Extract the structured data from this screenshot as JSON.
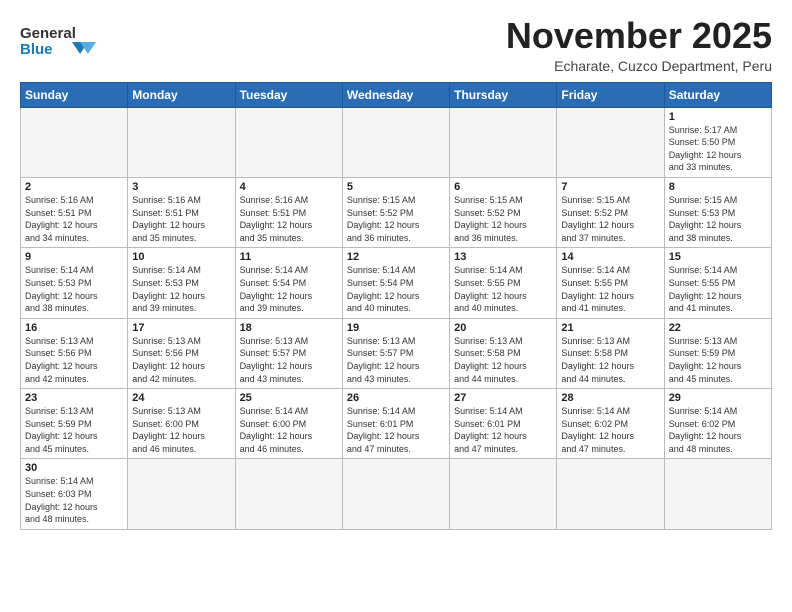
{
  "header": {
    "logo_general": "General",
    "logo_blue": "Blue",
    "month_title": "November 2025",
    "subtitle": "Echarate, Cuzco Department, Peru"
  },
  "weekdays": [
    "Sunday",
    "Monday",
    "Tuesday",
    "Wednesday",
    "Thursday",
    "Friday",
    "Saturday"
  ],
  "weeks": [
    [
      {
        "day": "",
        "info": ""
      },
      {
        "day": "",
        "info": ""
      },
      {
        "day": "",
        "info": ""
      },
      {
        "day": "",
        "info": ""
      },
      {
        "day": "",
        "info": ""
      },
      {
        "day": "",
        "info": ""
      },
      {
        "day": "1",
        "info": "Sunrise: 5:17 AM\nSunset: 5:50 PM\nDaylight: 12 hours\nand 33 minutes."
      }
    ],
    [
      {
        "day": "2",
        "info": "Sunrise: 5:16 AM\nSunset: 5:51 PM\nDaylight: 12 hours\nand 34 minutes."
      },
      {
        "day": "3",
        "info": "Sunrise: 5:16 AM\nSunset: 5:51 PM\nDaylight: 12 hours\nand 35 minutes."
      },
      {
        "day": "4",
        "info": "Sunrise: 5:16 AM\nSunset: 5:51 PM\nDaylight: 12 hours\nand 35 minutes."
      },
      {
        "day": "5",
        "info": "Sunrise: 5:15 AM\nSunset: 5:52 PM\nDaylight: 12 hours\nand 36 minutes."
      },
      {
        "day": "6",
        "info": "Sunrise: 5:15 AM\nSunset: 5:52 PM\nDaylight: 12 hours\nand 36 minutes."
      },
      {
        "day": "7",
        "info": "Sunrise: 5:15 AM\nSunset: 5:52 PM\nDaylight: 12 hours\nand 37 minutes."
      },
      {
        "day": "8",
        "info": "Sunrise: 5:15 AM\nSunset: 5:53 PM\nDaylight: 12 hours\nand 38 minutes."
      }
    ],
    [
      {
        "day": "9",
        "info": "Sunrise: 5:14 AM\nSunset: 5:53 PM\nDaylight: 12 hours\nand 38 minutes."
      },
      {
        "day": "10",
        "info": "Sunrise: 5:14 AM\nSunset: 5:53 PM\nDaylight: 12 hours\nand 39 minutes."
      },
      {
        "day": "11",
        "info": "Sunrise: 5:14 AM\nSunset: 5:54 PM\nDaylight: 12 hours\nand 39 minutes."
      },
      {
        "day": "12",
        "info": "Sunrise: 5:14 AM\nSunset: 5:54 PM\nDaylight: 12 hours\nand 40 minutes."
      },
      {
        "day": "13",
        "info": "Sunrise: 5:14 AM\nSunset: 5:55 PM\nDaylight: 12 hours\nand 40 minutes."
      },
      {
        "day": "14",
        "info": "Sunrise: 5:14 AM\nSunset: 5:55 PM\nDaylight: 12 hours\nand 41 minutes."
      },
      {
        "day": "15",
        "info": "Sunrise: 5:14 AM\nSunset: 5:55 PM\nDaylight: 12 hours\nand 41 minutes."
      }
    ],
    [
      {
        "day": "16",
        "info": "Sunrise: 5:13 AM\nSunset: 5:56 PM\nDaylight: 12 hours\nand 42 minutes."
      },
      {
        "day": "17",
        "info": "Sunrise: 5:13 AM\nSunset: 5:56 PM\nDaylight: 12 hours\nand 42 minutes."
      },
      {
        "day": "18",
        "info": "Sunrise: 5:13 AM\nSunset: 5:57 PM\nDaylight: 12 hours\nand 43 minutes."
      },
      {
        "day": "19",
        "info": "Sunrise: 5:13 AM\nSunset: 5:57 PM\nDaylight: 12 hours\nand 43 minutes."
      },
      {
        "day": "20",
        "info": "Sunrise: 5:13 AM\nSunset: 5:58 PM\nDaylight: 12 hours\nand 44 minutes."
      },
      {
        "day": "21",
        "info": "Sunrise: 5:13 AM\nSunset: 5:58 PM\nDaylight: 12 hours\nand 44 minutes."
      },
      {
        "day": "22",
        "info": "Sunrise: 5:13 AM\nSunset: 5:59 PM\nDaylight: 12 hours\nand 45 minutes."
      }
    ],
    [
      {
        "day": "23",
        "info": "Sunrise: 5:13 AM\nSunset: 5:59 PM\nDaylight: 12 hours\nand 45 minutes."
      },
      {
        "day": "24",
        "info": "Sunrise: 5:13 AM\nSunset: 6:00 PM\nDaylight: 12 hours\nand 46 minutes."
      },
      {
        "day": "25",
        "info": "Sunrise: 5:14 AM\nSunset: 6:00 PM\nDaylight: 12 hours\nand 46 minutes."
      },
      {
        "day": "26",
        "info": "Sunrise: 5:14 AM\nSunset: 6:01 PM\nDaylight: 12 hours\nand 47 minutes."
      },
      {
        "day": "27",
        "info": "Sunrise: 5:14 AM\nSunset: 6:01 PM\nDaylight: 12 hours\nand 47 minutes."
      },
      {
        "day": "28",
        "info": "Sunrise: 5:14 AM\nSunset: 6:02 PM\nDaylight: 12 hours\nand 47 minutes."
      },
      {
        "day": "29",
        "info": "Sunrise: 5:14 AM\nSunset: 6:02 PM\nDaylight: 12 hours\nand 48 minutes."
      }
    ],
    [
      {
        "day": "30",
        "info": "Sunrise: 5:14 AM\nSunset: 6:03 PM\nDaylight: 12 hours\nand 48 minutes."
      },
      {
        "day": "",
        "info": ""
      },
      {
        "day": "",
        "info": ""
      },
      {
        "day": "",
        "info": ""
      },
      {
        "day": "",
        "info": ""
      },
      {
        "day": "",
        "info": ""
      },
      {
        "day": "",
        "info": ""
      }
    ]
  ]
}
